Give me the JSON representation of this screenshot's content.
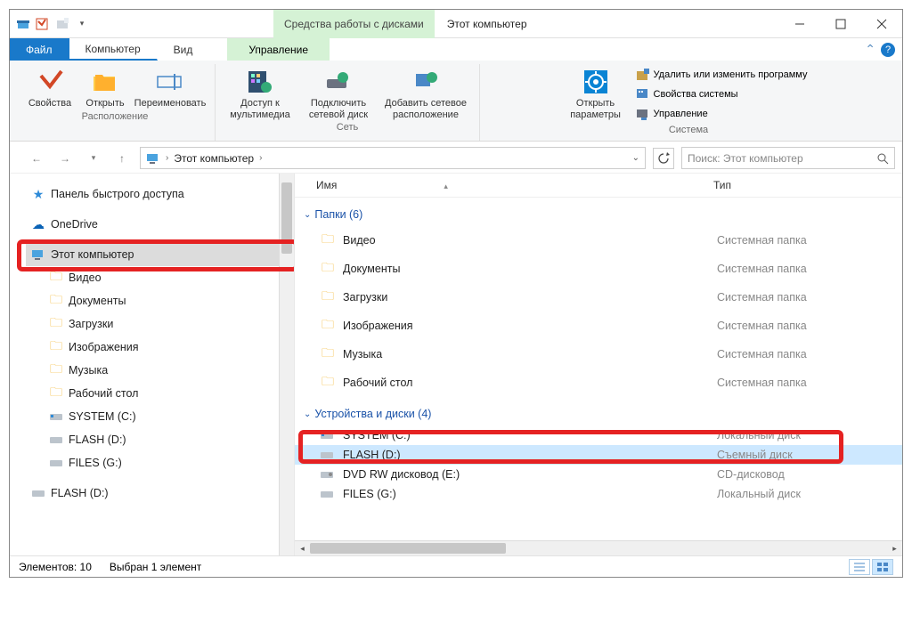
{
  "window": {
    "title": "Этот компьютер"
  },
  "qat": {
    "drive_tools_label": "Средства работы с дисками"
  },
  "tabs": {
    "file": "Файл",
    "computer": "Компьютер",
    "view": "Вид",
    "manage": "Управление"
  },
  "ribbon": {
    "group_location": {
      "title": "Расположение",
      "properties": "Свойства",
      "open": "Открыть",
      "rename": "Переименовать"
    },
    "group_network": {
      "title": "Сеть",
      "media_access": "Доступ к мультимедиа",
      "map_drive": "Подключить сетевой диск",
      "add_location": "Добавить сетевое расположение"
    },
    "group_system": {
      "title": "Система",
      "open_settings": "Открыть параметры",
      "uninstall": "Удалить или изменить программу",
      "sys_props": "Свойства системы",
      "manage": "Управление"
    }
  },
  "addr": {
    "crumb": "Этот компьютер"
  },
  "search": {
    "placeholder": "Поиск: Этот компьютер"
  },
  "columns": {
    "name": "Имя",
    "type": "Тип"
  },
  "nav": {
    "quick_access": "Панель быстрого доступа",
    "onedrive": "OneDrive",
    "this_pc": "Этот компьютер",
    "videos": "Видео",
    "documents": "Документы",
    "downloads": "Загрузки",
    "pictures": "Изображения",
    "music": "Музыка",
    "desktop": "Рабочий стол",
    "system_c": "SYSTEM (C:)",
    "flash_d": "FLASH (D:)",
    "files_g": "FILES (G:)",
    "flash_d2": "FLASH (D:)"
  },
  "groups": {
    "folders": "Папки (6)",
    "devices": "Устройства и диски (4)"
  },
  "items": {
    "folders": [
      {
        "name": "Видео",
        "type": "Системная папка"
      },
      {
        "name": "Документы",
        "type": "Системная папка"
      },
      {
        "name": "Загрузки",
        "type": "Системная папка"
      },
      {
        "name": "Изображения",
        "type": "Системная папка"
      },
      {
        "name": "Музыка",
        "type": "Системная папка"
      },
      {
        "name": "Рабочий стол",
        "type": "Системная папка"
      }
    ],
    "devices": [
      {
        "name": "SYSTEM (C:)",
        "type": "Локальный диск"
      },
      {
        "name": "FLASH (D:)",
        "type": "Съемный диск"
      },
      {
        "name": "DVD RW дисковод (E:)",
        "type": "CD-дисковод"
      },
      {
        "name": "FILES (G:)",
        "type": "Локальный диск"
      }
    ]
  },
  "status": {
    "count": "Элементов: 10",
    "selected": "Выбран 1 элемент"
  }
}
